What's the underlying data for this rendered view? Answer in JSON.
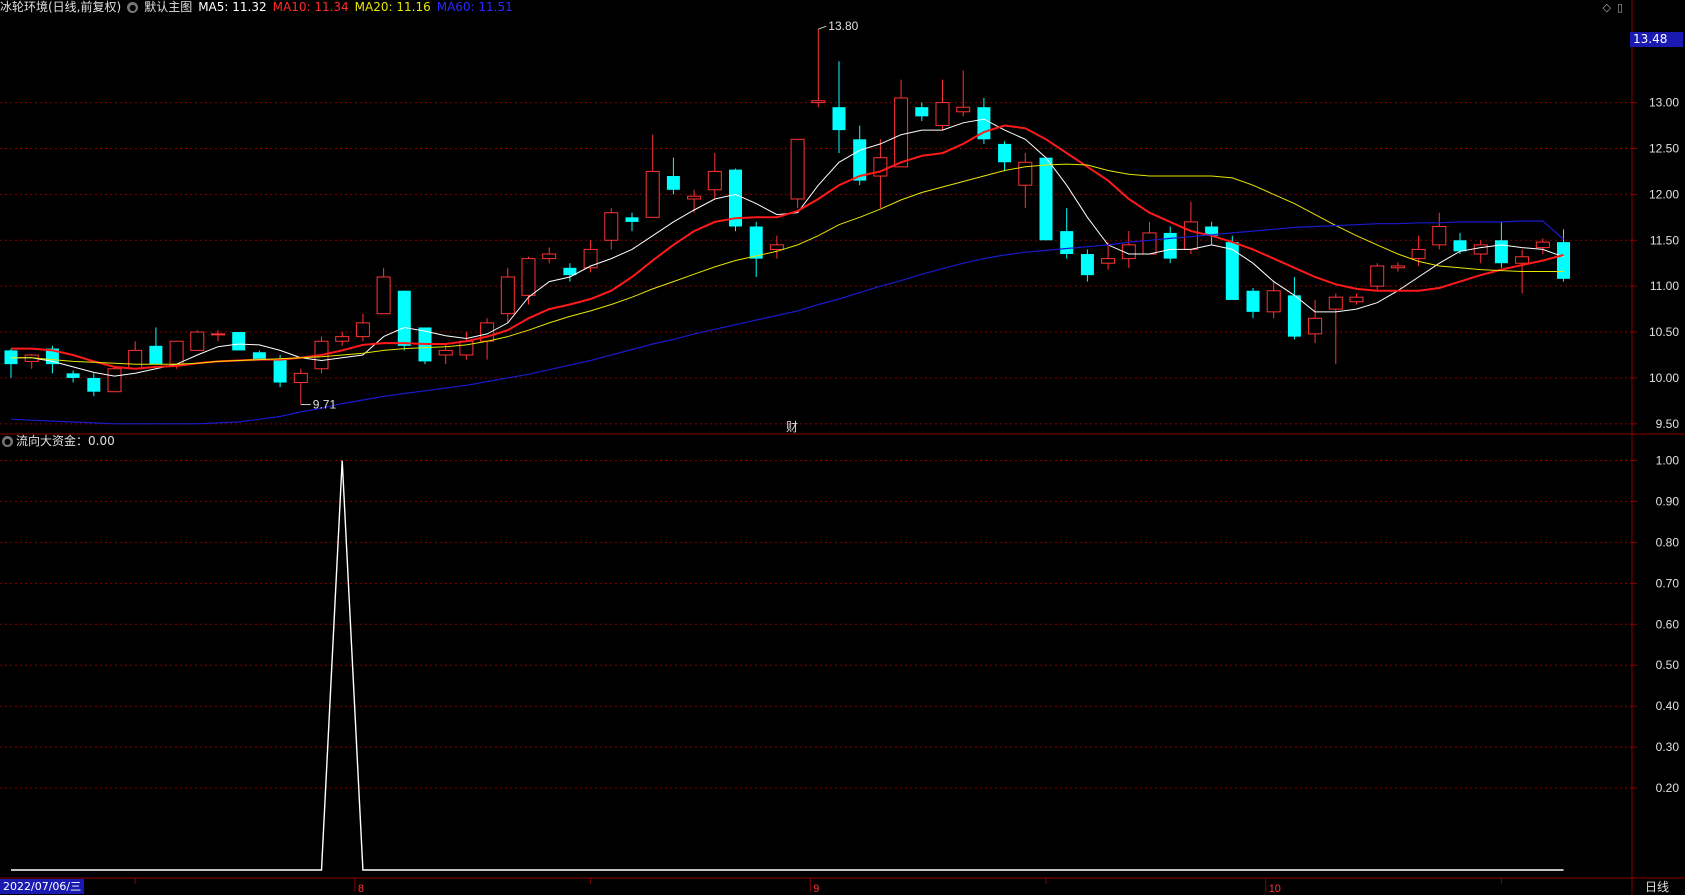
{
  "header": {
    "stock_name": "冰轮环境(日线,前复权)",
    "main_label": "默认主图",
    "ma5": "MA5: 11.32",
    "ma10": "MA10: 11.34",
    "ma20": "MA20: 11.16",
    "ma60": "MA60: 11.51"
  },
  "sub_indicator": {
    "label": "流向大资金：0.00"
  },
  "current_price_tag": "13.48",
  "date_label": "2022/07/06/三",
  "period_label": "日线",
  "cai_label": "财",
  "annotations": {
    "high": "13.80",
    "low": "9.71"
  },
  "colors": {
    "up": "#ff3333",
    "down": "#00ffff",
    "ma5": "#ffffff",
    "ma10": "#ff1a1a",
    "ma20": "#e6e600",
    "ma60": "#1a1acc",
    "grid": "#8b0000",
    "axis_text": "#e0e0e0"
  },
  "chart_data": [
    {
      "type": "candlestick",
      "title": "冰轮环境(日线,前复权)",
      "ylim": [
        9.4,
        13.9
      ],
      "yticks": [
        "13.00",
        "12.50",
        "12.00",
        "11.50",
        "11.00",
        "10.50",
        "10.00",
        "9.50"
      ],
      "xticks": [
        "8",
        "9",
        "10"
      ],
      "candles": [
        {
          "o": 10.15,
          "c": 10.3,
          "h": 10.32,
          "l": 10.0,
          "up": false
        },
        {
          "o": 10.18,
          "c": 10.25,
          "h": 10.26,
          "l": 10.1,
          "up": true
        },
        {
          "o": 10.32,
          "c": 10.15,
          "h": 10.35,
          "l": 10.05,
          "up": false
        },
        {
          "o": 10.05,
          "c": 10.0,
          "h": 10.08,
          "l": 9.95,
          "up": false
        },
        {
          "o": 10.0,
          "c": 9.85,
          "h": 10.05,
          "l": 9.8,
          "up": false
        },
        {
          "o": 9.85,
          "c": 10.1,
          "h": 10.12,
          "l": 9.85,
          "up": true
        },
        {
          "o": 10.1,
          "c": 10.3,
          "h": 10.4,
          "l": 10.1,
          "up": true
        },
        {
          "o": 10.35,
          "c": 10.15,
          "h": 10.55,
          "l": 10.15,
          "up": false
        },
        {
          "o": 10.15,
          "c": 10.4,
          "h": 10.4,
          "l": 10.1,
          "up": true
        },
        {
          "o": 10.3,
          "c": 10.5,
          "h": 10.52,
          "l": 10.3,
          "up": true
        },
        {
          "o": 10.48,
          "c": 10.48,
          "h": 10.52,
          "l": 10.4,
          "up": true
        },
        {
          "o": 10.5,
          "c": 10.3,
          "h": 10.5,
          "l": 10.3,
          "up": false
        },
        {
          "o": 10.28,
          "c": 10.2,
          "h": 10.3,
          "l": 10.2,
          "up": false
        },
        {
          "o": 10.2,
          "c": 9.95,
          "h": 10.25,
          "l": 9.9,
          "up": false
        },
        {
          "o": 9.95,
          "c": 10.05,
          "h": 10.1,
          "l": 9.71,
          "up": true
        },
        {
          "o": 10.1,
          "c": 10.4,
          "h": 10.45,
          "l": 10.05,
          "up": true
        },
        {
          "o": 10.4,
          "c": 10.45,
          "h": 10.5,
          "l": 10.35,
          "up": true
        },
        {
          "o": 10.45,
          "c": 10.6,
          "h": 10.7,
          "l": 10.4,
          "up": true
        },
        {
          "o": 10.7,
          "c": 11.1,
          "h": 11.2,
          "l": 10.7,
          "up": true
        },
        {
          "o": 10.95,
          "c": 10.35,
          "h": 10.95,
          "l": 10.3,
          "up": false
        },
        {
          "o": 10.55,
          "c": 10.18,
          "h": 10.55,
          "l": 10.15,
          "up": false
        },
        {
          "o": 10.25,
          "c": 10.3,
          "h": 10.38,
          "l": 10.15,
          "up": true
        },
        {
          "o": 10.25,
          "c": 10.4,
          "h": 10.5,
          "l": 10.2,
          "up": true
        },
        {
          "o": 10.4,
          "c": 10.6,
          "h": 10.65,
          "l": 10.2,
          "up": true
        },
        {
          "o": 10.7,
          "c": 11.1,
          "h": 11.2,
          "l": 10.6,
          "up": true
        },
        {
          "o": 10.9,
          "c": 11.3,
          "h": 11.32,
          "l": 10.8,
          "up": true
        },
        {
          "o": 11.3,
          "c": 11.35,
          "h": 11.42,
          "l": 11.25,
          "up": true
        },
        {
          "o": 11.2,
          "c": 11.12,
          "h": 11.25,
          "l": 11.05,
          "up": false
        },
        {
          "o": 11.2,
          "c": 11.4,
          "h": 11.5,
          "l": 11.15,
          "up": true
        },
        {
          "o": 11.5,
          "c": 11.8,
          "h": 11.85,
          "l": 11.4,
          "up": true
        },
        {
          "o": 11.75,
          "c": 11.7,
          "h": 11.8,
          "l": 11.6,
          "up": false
        },
        {
          "o": 11.75,
          "c": 12.25,
          "h": 12.65,
          "l": 11.75,
          "up": true
        },
        {
          "o": 12.2,
          "c": 12.05,
          "h": 12.4,
          "l": 12.0,
          "up": false
        },
        {
          "o": 11.95,
          "c": 11.98,
          "h": 12.05,
          "l": 11.8,
          "up": true
        },
        {
          "o": 12.05,
          "c": 12.25,
          "h": 12.45,
          "l": 11.95,
          "up": true
        },
        {
          "o": 12.27,
          "c": 11.65,
          "h": 12.28,
          "l": 11.6,
          "up": false
        },
        {
          "o": 11.65,
          "c": 11.3,
          "h": 11.7,
          "l": 11.1,
          "up": false
        },
        {
          "o": 11.4,
          "c": 11.45,
          "h": 11.55,
          "l": 11.3,
          "up": true
        },
        {
          "o": 11.95,
          "c": 12.6,
          "h": 12.6,
          "l": 11.85,
          "up": true
        },
        {
          "o": 13.0,
          "c": 13.02,
          "h": 13.8,
          "l": 12.95,
          "up": true
        },
        {
          "o": 12.95,
          "c": 12.7,
          "h": 13.45,
          "l": 12.45,
          "up": false
        },
        {
          "o": 12.6,
          "c": 12.15,
          "h": 12.75,
          "l": 12.1,
          "up": false
        },
        {
          "o": 12.2,
          "c": 12.4,
          "h": 12.6,
          "l": 11.85,
          "up": true
        },
        {
          "o": 12.3,
          "c": 13.05,
          "h": 13.25,
          "l": 12.3,
          "up": true
        },
        {
          "o": 12.95,
          "c": 12.85,
          "h": 13.0,
          "l": 12.8,
          "up": false
        },
        {
          "o": 12.75,
          "c": 13.0,
          "h": 13.25,
          "l": 12.7,
          "up": true
        },
        {
          "o": 12.9,
          "c": 12.95,
          "h": 13.35,
          "l": 12.85,
          "up": true
        },
        {
          "o": 12.95,
          "c": 12.6,
          "h": 13.05,
          "l": 12.55,
          "up": false
        },
        {
          "o": 12.55,
          "c": 12.35,
          "h": 12.58,
          "l": 12.25,
          "up": false
        },
        {
          "o": 12.1,
          "c": 12.35,
          "h": 12.45,
          "l": 11.85,
          "up": true
        },
        {
          "o": 12.4,
          "c": 11.5,
          "h": 12.4,
          "l": 11.5,
          "up": false
        },
        {
          "o": 11.6,
          "c": 11.35,
          "h": 11.85,
          "l": 11.3,
          "up": false
        },
        {
          "o": 11.35,
          "c": 11.12,
          "h": 11.4,
          "l": 11.05,
          "up": false
        },
        {
          "o": 11.25,
          "c": 11.3,
          "h": 11.48,
          "l": 11.18,
          "up": true
        },
        {
          "o": 11.3,
          "c": 11.45,
          "h": 11.6,
          "l": 11.2,
          "up": true
        },
        {
          "o": 11.35,
          "c": 11.58,
          "h": 11.7,
          "l": 11.35,
          "up": true
        },
        {
          "o": 11.58,
          "c": 11.3,
          "h": 11.65,
          "l": 11.25,
          "up": false
        },
        {
          "o": 11.4,
          "c": 11.7,
          "h": 11.92,
          "l": 11.35,
          "up": true
        },
        {
          "o": 11.65,
          "c": 11.55,
          "h": 11.7,
          "l": 11.45,
          "up": false
        },
        {
          "o": 11.48,
          "c": 10.85,
          "h": 11.55,
          "l": 10.85,
          "up": false
        },
        {
          "o": 10.95,
          "c": 10.72,
          "h": 10.98,
          "l": 10.65,
          "up": false
        },
        {
          "o": 10.72,
          "c": 10.95,
          "h": 11.05,
          "l": 10.65,
          "up": true
        },
        {
          "o": 10.9,
          "c": 10.45,
          "h": 11.1,
          "l": 10.42,
          "up": false
        },
        {
          "o": 10.48,
          "c": 10.65,
          "h": 10.85,
          "l": 10.38,
          "up": true
        },
        {
          "o": 10.75,
          "c": 10.88,
          "h": 10.92,
          "l": 10.15,
          "up": true
        },
        {
          "o": 10.83,
          "c": 10.88,
          "h": 10.92,
          "l": 10.8,
          "up": true
        },
        {
          "o": 11.0,
          "c": 11.22,
          "h": 11.25,
          "l": 10.95,
          "up": true
        },
        {
          "o": 11.2,
          "c": 11.22,
          "h": 11.26,
          "l": 11.16,
          "up": true
        },
        {
          "o": 11.3,
          "c": 11.4,
          "h": 11.55,
          "l": 11.22,
          "up": true
        },
        {
          "o": 11.45,
          "c": 11.65,
          "h": 11.8,
          "l": 11.4,
          "up": true
        },
        {
          "o": 11.5,
          "c": 11.38,
          "h": 11.58,
          "l": 11.35,
          "up": false
        },
        {
          "o": 11.35,
          "c": 11.45,
          "h": 11.5,
          "l": 11.25,
          "up": true
        },
        {
          "o": 11.5,
          "c": 11.25,
          "h": 11.7,
          "l": 11.2,
          "up": false
        },
        {
          "o": 11.25,
          "c": 11.32,
          "h": 11.4,
          "l": 10.92,
          "up": true
        },
        {
          "o": 11.42,
          "c": 11.48,
          "h": 11.52,
          "l": 11.35,
          "up": true
        },
        {
          "o": 11.48,
          "c": 11.08,
          "h": 11.62,
          "l": 11.05,
          "up": false
        }
      ],
      "series": [
        {
          "name": "MA5",
          "values": [
            10.22,
            10.22,
            10.18,
            10.12,
            10.06,
            10.02,
            10.05,
            10.1,
            10.15,
            10.25,
            10.34,
            10.37,
            10.36,
            10.3,
            10.22,
            10.19,
            10.22,
            10.25,
            10.45,
            10.55,
            10.51,
            10.46,
            10.43,
            10.48,
            10.6,
            10.88,
            11.05,
            11.1,
            11.22,
            11.3,
            11.4,
            11.55,
            11.7,
            11.83,
            11.95,
            12.0,
            11.9,
            11.78,
            11.8,
            12.1,
            12.35,
            12.48,
            12.55,
            12.65,
            12.7,
            12.7,
            12.78,
            12.82,
            12.7,
            12.6,
            12.4,
            12.1,
            11.75,
            11.45,
            11.35,
            11.35,
            11.4,
            11.4,
            11.45,
            11.4,
            11.25,
            11.05,
            10.9,
            10.72,
            10.72,
            10.75,
            10.82,
            10.95,
            11.1,
            11.25,
            11.38,
            11.42,
            11.45,
            11.42,
            11.4,
            11.32
          ]
        },
        {
          "name": "MA10",
          "values": [
            10.32,
            10.32,
            10.3,
            10.25,
            10.18,
            10.12,
            10.1,
            10.12,
            10.13,
            10.16,
            10.18,
            10.19,
            10.2,
            10.2,
            10.22,
            10.25,
            10.3,
            10.36,
            10.38,
            10.38,
            10.37,
            10.37,
            10.4,
            10.45,
            10.52,
            10.65,
            10.75,
            10.8,
            10.86,
            10.95,
            11.1,
            11.28,
            11.45,
            11.6,
            11.7,
            11.74,
            11.75,
            11.75,
            11.82,
            11.95,
            12.1,
            12.2,
            12.25,
            12.35,
            12.42,
            12.45,
            12.55,
            12.68,
            12.75,
            12.72,
            12.6,
            12.45,
            12.3,
            12.15,
            11.95,
            11.8,
            11.7,
            11.6,
            11.55,
            11.48,
            11.4,
            11.3,
            11.2,
            11.1,
            11.02,
            10.97,
            10.95,
            10.95,
            10.95,
            10.98,
            11.05,
            11.12,
            11.18,
            11.23,
            11.28,
            11.34
          ]
        },
        {
          "name": "MA20",
          "values": [
            10.22,
            10.22,
            10.2,
            10.18,
            10.17,
            10.16,
            10.15,
            10.15,
            10.15,
            10.16,
            10.18,
            10.19,
            10.2,
            10.21,
            10.22,
            10.23,
            10.25,
            10.27,
            10.3,
            10.32,
            10.33,
            10.34,
            10.36,
            10.4,
            10.45,
            10.52,
            10.6,
            10.67,
            10.73,
            10.8,
            10.88,
            10.97,
            11.05,
            11.13,
            11.21,
            11.28,
            11.33,
            11.38,
            11.45,
            11.55,
            11.67,
            11.75,
            11.84,
            11.94,
            12.02,
            12.08,
            12.14,
            12.2,
            12.26,
            12.3,
            12.32,
            12.33,
            12.32,
            12.26,
            12.22,
            12.2,
            12.2,
            12.2,
            12.2,
            12.18,
            12.1,
            12.0,
            11.9,
            11.78,
            11.66,
            11.55,
            11.45,
            11.35,
            11.27,
            11.22,
            11.2,
            11.18,
            11.17,
            11.16,
            11.16,
            11.16
          ]
        },
        {
          "name": "MA60",
          "values": [
            9.55,
            9.54,
            9.53,
            9.52,
            9.51,
            9.5,
            9.5,
            9.5,
            9.5,
            9.5,
            9.51,
            9.52,
            9.55,
            9.58,
            9.63,
            9.67,
            9.72,
            9.76,
            9.8,
            9.83,
            9.86,
            9.89,
            9.92,
            9.96,
            10.0,
            10.04,
            10.09,
            10.14,
            10.19,
            10.25,
            10.31,
            10.37,
            10.42,
            10.48,
            10.53,
            10.58,
            10.63,
            10.68,
            10.73,
            10.8,
            10.86,
            10.93,
            11.0,
            11.06,
            11.13,
            11.19,
            11.25,
            11.3,
            11.34,
            11.37,
            11.39,
            11.41,
            11.43,
            11.45,
            11.48,
            11.5,
            11.52,
            11.54,
            11.56,
            11.58,
            11.6,
            11.62,
            11.64,
            11.65,
            11.66,
            11.67,
            11.68,
            11.68,
            11.69,
            11.69,
            11.7,
            11.7,
            11.7,
            11.71,
            11.71,
            11.51
          ]
        }
      ]
    },
    {
      "type": "line",
      "title": "流向大资金：0.00",
      "ylim": [
        0,
        1.05
      ],
      "yticks": [
        "1.00",
        "0.90",
        "0.80",
        "0.70",
        "0.60",
        "0.50",
        "0.40",
        "0.30",
        "0.20"
      ],
      "series": [
        {
          "name": "流向大资金",
          "values": [
            0,
            0,
            0,
            0,
            0,
            0,
            0,
            0,
            0,
            0,
            0,
            0,
            0,
            0,
            0,
            0,
            1,
            0,
            0,
            0,
            0,
            0,
            0,
            0,
            0,
            0,
            0,
            0,
            0,
            0,
            0,
            0,
            0,
            0,
            0,
            0,
            0,
            0,
            0,
            0,
            0,
            0,
            0,
            0,
            0,
            0,
            0,
            0,
            0,
            0,
            0,
            0,
            0,
            0,
            0,
            0,
            0,
            0,
            0,
            0,
            0,
            0,
            0,
            0,
            0,
            0,
            0,
            0,
            0,
            0,
            0,
            0,
            0,
            0,
            0,
            0
          ]
        }
      ]
    }
  ]
}
